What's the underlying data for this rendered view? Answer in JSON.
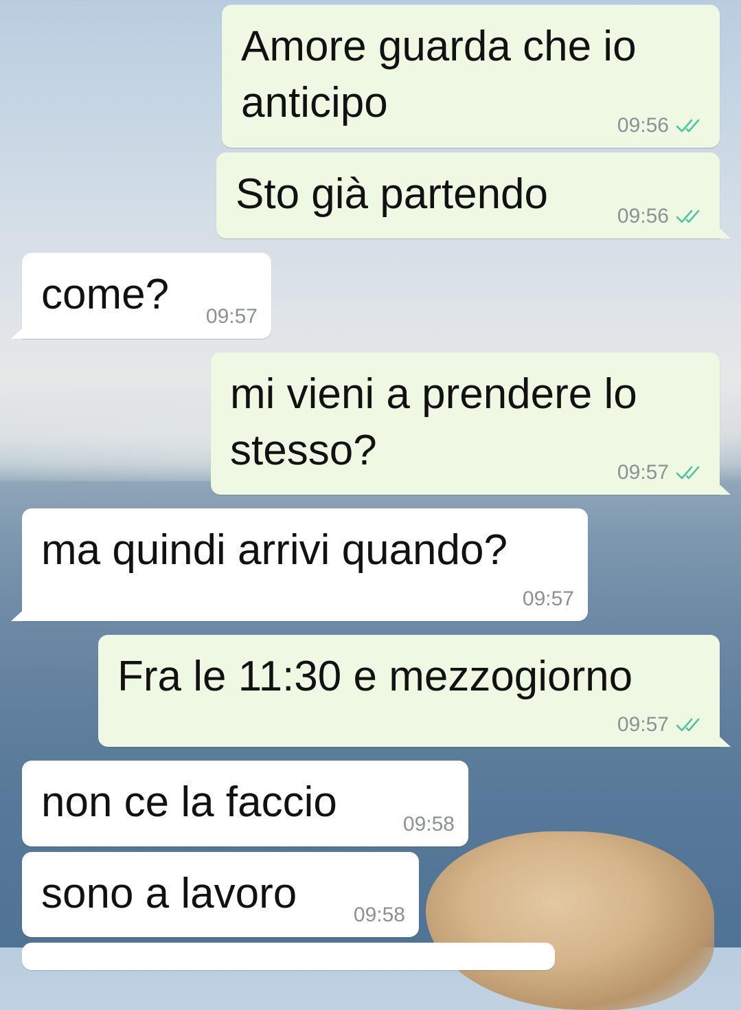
{
  "chat": {
    "messages": [
      {
        "direction": "outgoing",
        "lines": [
          "Amore guarda che io",
          "anticipo"
        ],
        "time": "09:56",
        "status": "read"
      },
      {
        "direction": "outgoing",
        "lines": [
          "Sto già partendo"
        ],
        "time": "09:56",
        "status": "read"
      },
      {
        "direction": "incoming",
        "lines": [
          "come?"
        ],
        "time": "09:57"
      },
      {
        "direction": "outgoing",
        "lines": [
          "mi vieni a prendere lo",
          "stesso?"
        ],
        "time": "09:57",
        "status": "read"
      },
      {
        "direction": "incoming",
        "lines": [
          "ma quindi arrivi quando?"
        ],
        "time": "09:57"
      },
      {
        "direction": "outgoing",
        "lines": [
          "Fra le 11:30 e mezzogiorno"
        ],
        "time": "09:57",
        "status": "read"
      },
      {
        "direction": "incoming",
        "lines": [
          "non ce la faccio"
        ],
        "time": "09:58"
      },
      {
        "direction": "incoming",
        "lines": [
          "sono a lavoro"
        ],
        "time": "09:58"
      }
    ]
  },
  "icons": {
    "read_receipt": "double-check-icon"
  },
  "colors": {
    "outgoing_bubble": "#eef8e3",
    "incoming_bubble": "#ffffff",
    "read_receipt": "#4fc3a1",
    "timestamp": "#8a9296"
  }
}
